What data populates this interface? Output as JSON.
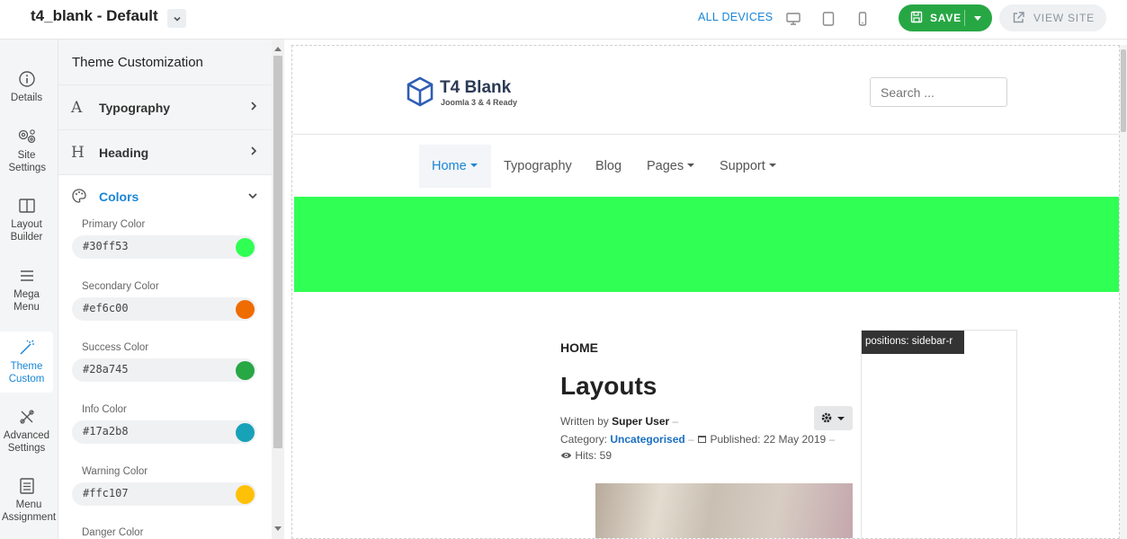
{
  "app": {
    "title": "t4_blank - Default"
  },
  "toolbar": {
    "all_devices": "ALL DEVICES",
    "save_label": "SAVE",
    "view_site_label": "VIEW SITE",
    "accent": "#27a744"
  },
  "rail": {
    "items": [
      {
        "label": "Details",
        "icon": "info-icon"
      },
      {
        "label": "Site Settings",
        "icon": "gears-icon"
      },
      {
        "label": "Layout Builder",
        "icon": "layout-icon"
      },
      {
        "label": "Mega Menu",
        "icon": "menu-icon"
      },
      {
        "label": "Theme Custom",
        "icon": "magic-wand-icon",
        "active": true
      },
      {
        "label": "Advanced Settings",
        "icon": "tools-icon"
      },
      {
        "label": "Menu Assignment",
        "icon": "list-icon"
      }
    ]
  },
  "panel": {
    "title": "Theme Customization",
    "sections": [
      {
        "letter": "A",
        "label": "Typography"
      },
      {
        "letter": "H",
        "label": "Heading"
      }
    ],
    "colors_label": "Colors",
    "colors": [
      {
        "label": "Primary Color",
        "value": "#30ff53",
        "swatch": "#30ff53"
      },
      {
        "label": "Secondary Color",
        "value": "#ef6c00",
        "swatch": "#ef6c00"
      },
      {
        "label": "Success Color",
        "value": "#28a745",
        "swatch": "#28a745"
      },
      {
        "label": "Info Color",
        "value": "#17a2b8",
        "swatch": "#17a2b8"
      },
      {
        "label": "Warning Color",
        "value": "#ffc107",
        "swatch": "#ffc107"
      },
      {
        "label": "Danger Color",
        "value": "",
        "swatch": ""
      }
    ]
  },
  "preview": {
    "logo_name": "T4 Blank",
    "logo_tagline": "Joomla 3 & 4 Ready",
    "search_placeholder": "Search ...",
    "nav": [
      "Home",
      "Typography",
      "Blog",
      "Pages",
      "Support"
    ],
    "banner_color": "#30ff53",
    "breadcrumb": "HOME",
    "page_title": "Layouts",
    "written_by_label": "Written by",
    "author": "Super User",
    "category_label": "Category:",
    "category": "Uncategorised",
    "published": "Published: 22 May 2019",
    "hits": "Hits: 59",
    "sidebar_tag": "positions: sidebar-r"
  }
}
